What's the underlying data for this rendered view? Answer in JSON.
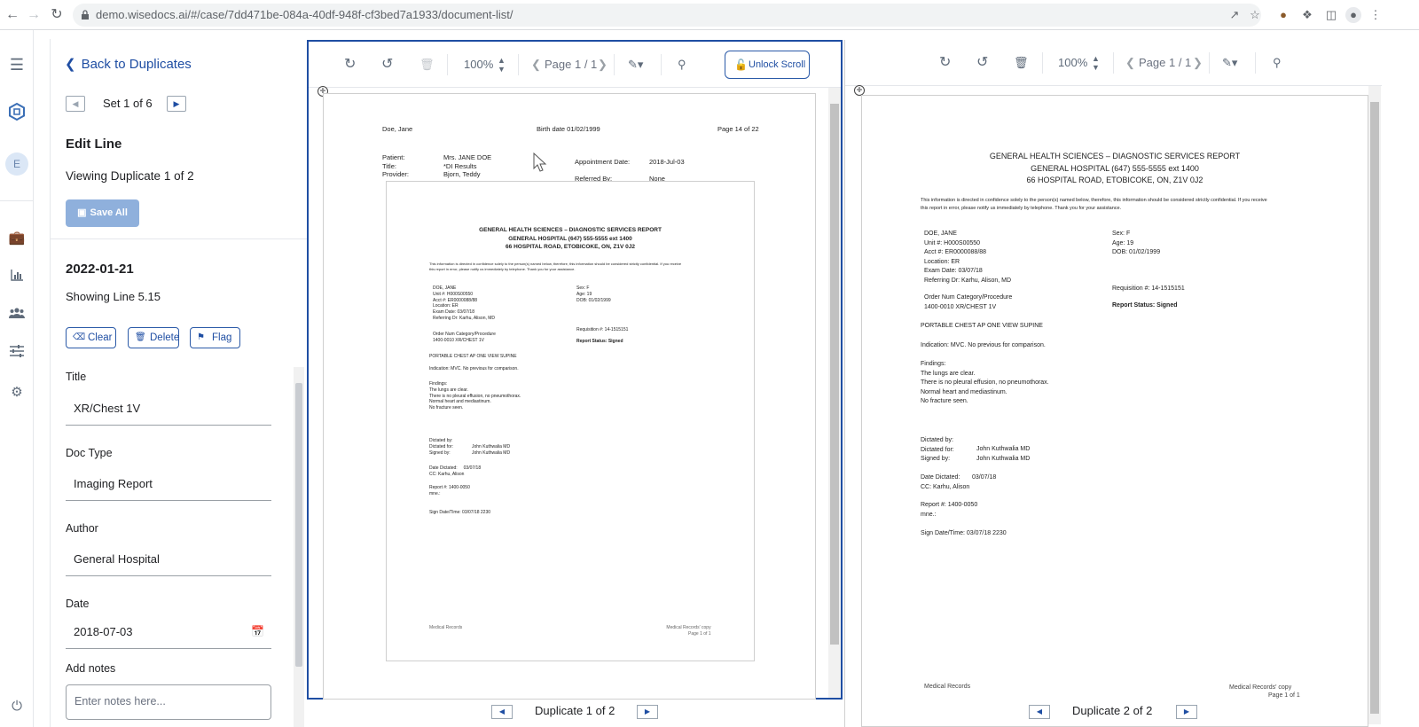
{
  "browser": {
    "url": "demo.wisedocs.ai/#/case/7dd471be-084a-40df-948f-cf3bed7a1933/document-list/"
  },
  "rail": {
    "avatar_letter": "E"
  },
  "panel": {
    "back_label": "Back to Duplicates",
    "set_label": "Set 1 of 6",
    "edit_title": "Edit Line",
    "viewing_label": "Viewing Duplicate 1 of 2",
    "save_all_label": "Save All",
    "date_heading": "2022-01-21",
    "showing_label": "Showing Line 5.15",
    "clear_label": "Clear",
    "delete_label": "Delete",
    "flag_label": "Flag",
    "fields": {
      "title_label": "Title",
      "title_value": "XR/Chest 1V",
      "doctype_label": "Doc Type",
      "doctype_value": "Imaging Report",
      "author_label": "Author",
      "author_value": "General Hospital",
      "date_label": "Date",
      "date_value": "2018-07-03",
      "notes_label": "Add notes",
      "notes_placeholder": "Enter notes here..."
    }
  },
  "viewer1": {
    "zoom": "100%",
    "page": "Page 1 / 1",
    "unlock_label": "Unlock Scroll",
    "footer_label": "Duplicate 1 of 2",
    "header": {
      "name": "Doe, Jane",
      "birth": "Birth date 01/02/1999",
      "pageof": "Page 14 of 22"
    },
    "meta": {
      "patient_k": "Patient:",
      "patient_v": "Mrs. JANE DOE",
      "title_k": "Title:",
      "title_v": "*DI Results",
      "provider_k": "Provider:",
      "provider_v": "Bjorn, Teddy",
      "appt_k": "Appointment Date:",
      "appt_v": "2018-Jul-03",
      "ref_k": "Referred By:",
      "ref_v": "None"
    },
    "sign_line": "Sign Date/Time: 03/07/18  2230"
  },
  "viewer2": {
    "zoom": "100%",
    "page": "Page 1 / 1",
    "footer_label": "Duplicate 2 of 2",
    "sign_line": "Sign Date/Time: 03/07/18  2230"
  },
  "report": {
    "h1": "GENERAL HEALTH SCIENCES – DIAGNOSTIC SERVICES REPORT",
    "h2": "GENERAL HOSPITAL  (647) 555-5555 ext 1400",
    "h3": "66 HOSPITAL ROAD, ETOBICOKE, ON, Z1V 0J2",
    "conf1": "This information is directed in confidence solely to the person(s) named below, therefore, this information should be considered strictly confidential. If you receive",
    "conf2": "this report in error, please notify us immediately by telephone. Thank you for your assistance.",
    "left": [
      "DOE, JANE",
      "Unit #: H000S00550",
      "Acct #: ER0000088/88",
      "Location: ER",
      "Exam Date: 03/07/18",
      "Referring Dr: Karhu, Alison, MD"
    ],
    "right": [
      "Sex: F",
      "Age: 19",
      "DOB: 01/02/1999"
    ],
    "requisition": "Requisition #: 14-1515151",
    "order1": "Order Num   Category/Procedure",
    "order2": "1400-0010   XR/CHEST 1V",
    "status": "Report Status: Signed",
    "exam": "PORTABLE CHEST AP ONE VIEW SUPINE",
    "indication": "Indication: MVC. No previous for comparison.",
    "findings": [
      "Findings:",
      "The lungs are clear.",
      "There is no pleural effusion, no pneumothorax.",
      "Normal heart and mediastinum.",
      "No fracture seen."
    ],
    "dict1": "Dictated by:",
    "dict2k": "Dictated for:",
    "dict2v": "John Kuthwalia MD",
    "dict3k": "Signed by:",
    "dict3v": "John Kuthwalia MD",
    "datek": "Date Dictated:",
    "datev": "03/07/18",
    "cc": "CC: Karhu, Alison",
    "reportno": "Report #: 1400-0050",
    "mne": "mne.:",
    "footer_left": "Medical Records",
    "footer_right": "Medical Records' copy",
    "footer_page": "Page 1 of 1"
  }
}
